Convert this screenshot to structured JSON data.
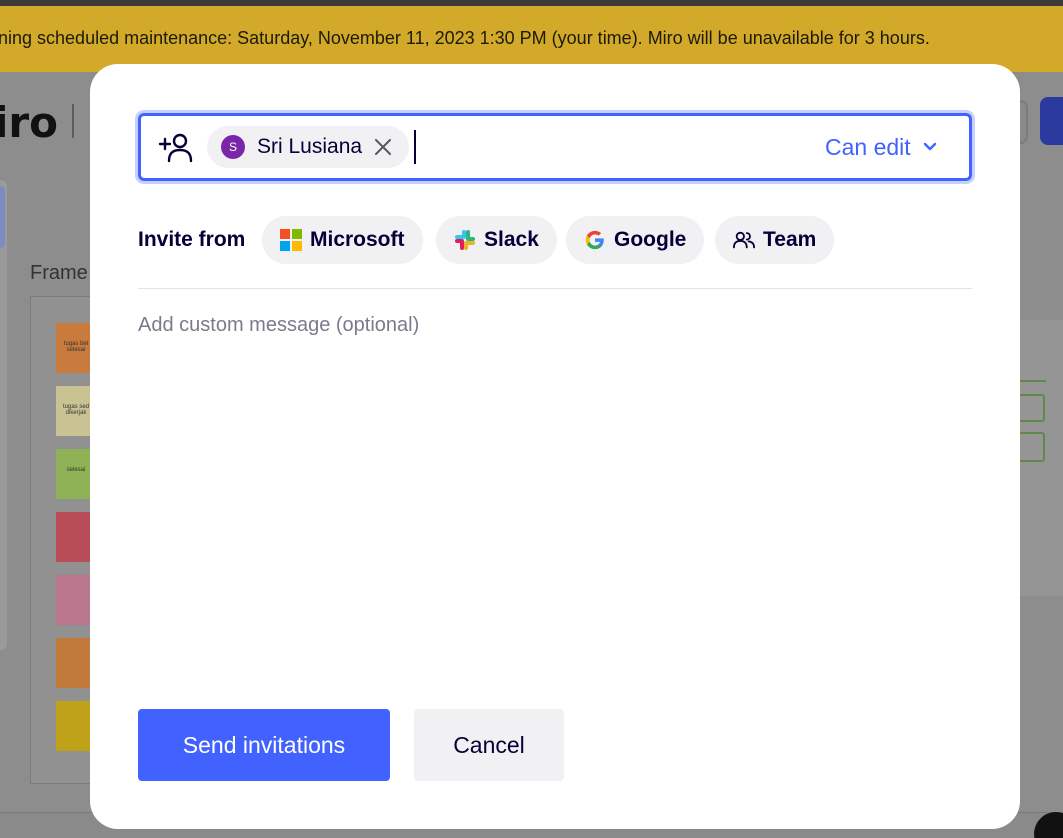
{
  "banner": {
    "text": "ning scheduled maintenance: Saturday, November 11, 2023 1:30 PM (your time). Miro will be unavailable for 3 hours."
  },
  "app": {
    "logo_text": "iro",
    "frame_label": "Frame",
    "stickies": [
      {
        "text": "tugas bel\nselesai",
        "color": "#c97a3d"
      },
      {
        "text": "tugas sed\ndikerjak",
        "color": "#c9c393"
      },
      {
        "text": "selesai",
        "color": "#8fb256"
      },
      {
        "text": "",
        "color": "#b84c57"
      },
      {
        "text": "",
        "color": "#b9768c"
      },
      {
        "text": "",
        "color": "#c27a3b"
      },
      {
        "text": "",
        "color": "#bfa21a"
      }
    ]
  },
  "modal": {
    "invitee": {
      "initial": "S",
      "name": "Sri Lusiana"
    },
    "permission": "Can edit",
    "invite_from_label": "Invite from",
    "sources": [
      "Microsoft",
      "Slack",
      "Google",
      "Team"
    ],
    "message_placeholder": "Add custom message (optional)",
    "send_label": "Send invitations",
    "cancel_label": "Cancel"
  },
  "colors": {
    "accent": "#4262ff",
    "banner": "#d3a92a",
    "avatar": "#7a26a8"
  },
  "icons": [
    "add-user-icon",
    "close-icon",
    "chevron-down-icon",
    "microsoft-icon",
    "slack-icon",
    "google-icon",
    "team-icon"
  ]
}
